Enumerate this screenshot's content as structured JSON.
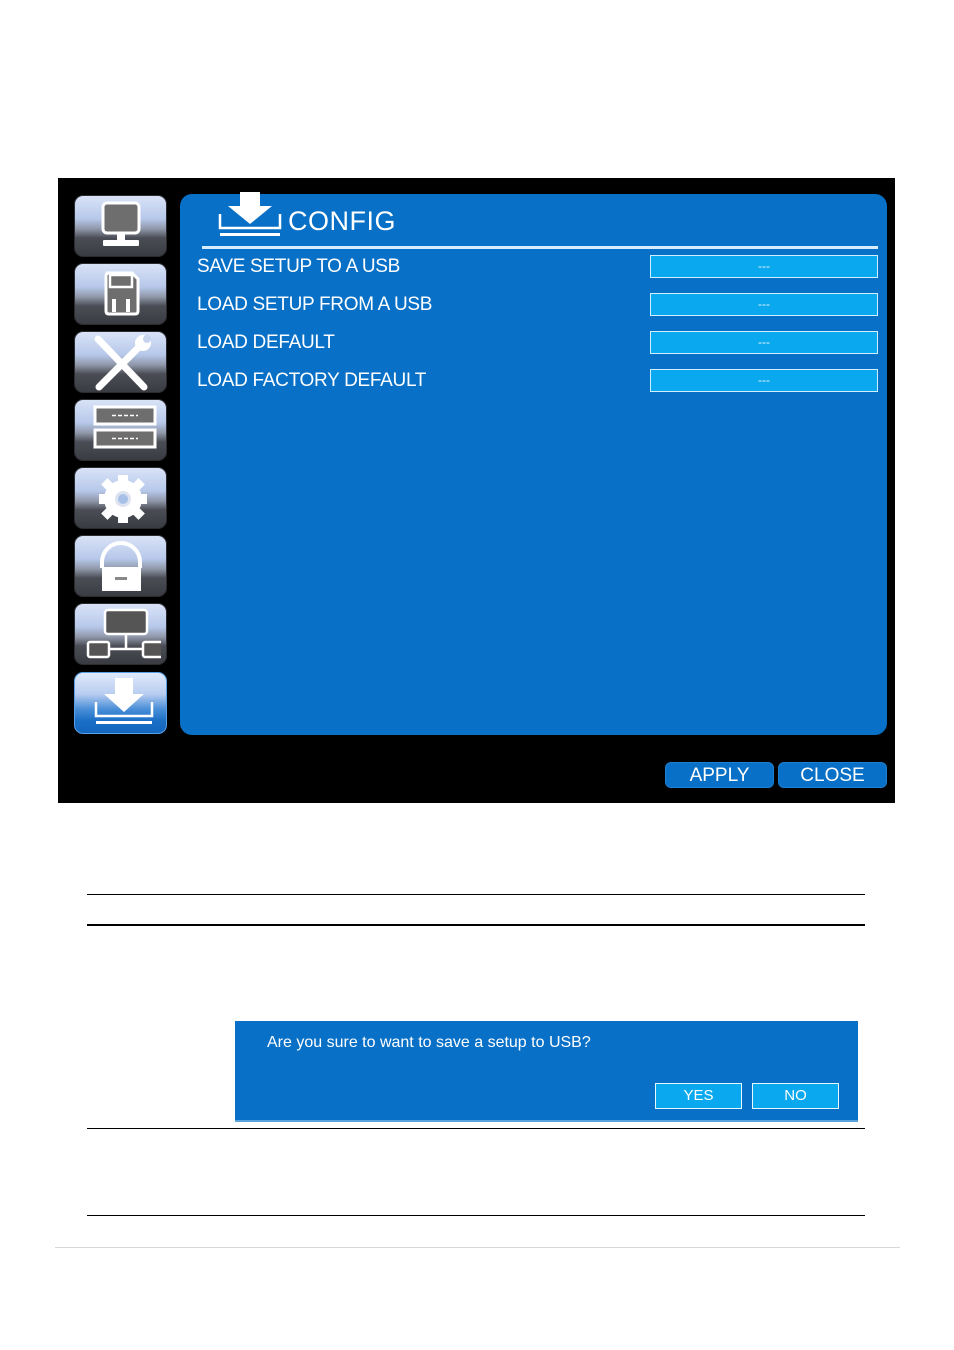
{
  "window": {
    "title": "CONFIG",
    "title_icon": "download-tray-icon"
  },
  "sidebar": {
    "items": [
      {
        "name": "display",
        "icon": "monitor-icon",
        "active": false
      },
      {
        "name": "record",
        "icon": "floppy-disk-icon",
        "active": false
      },
      {
        "name": "system",
        "icon": "tools-icon",
        "active": false
      },
      {
        "name": "storage",
        "icon": "hdd-list-icon",
        "active": false
      },
      {
        "name": "settings",
        "icon": "gear-icon",
        "active": false
      },
      {
        "name": "security",
        "icon": "lock-icon",
        "active": false
      },
      {
        "name": "network",
        "icon": "network-icon",
        "active": false
      },
      {
        "name": "config",
        "icon": "download-tray-icon",
        "active": true
      }
    ]
  },
  "rows": [
    {
      "label": "SAVE SETUP TO A USB",
      "value": "---"
    },
    {
      "label": "LOAD SETUP FROM A USB",
      "value": "---"
    },
    {
      "label": "LOAD DEFAULT",
      "value": "---"
    },
    {
      "label": "LOAD FACTORY DEFAULT",
      "value": "---"
    }
  ],
  "footer": {
    "apply_label": "APPLY",
    "close_label": "CLOSE"
  },
  "dialog": {
    "message": "Are you sure  to want to save a setup to USB?",
    "yes_label": "YES",
    "no_label": "NO"
  },
  "colors": {
    "panel_blue": "#0870c6",
    "value_cyan": "#0aa8ee",
    "screen_bg": "#000000"
  }
}
